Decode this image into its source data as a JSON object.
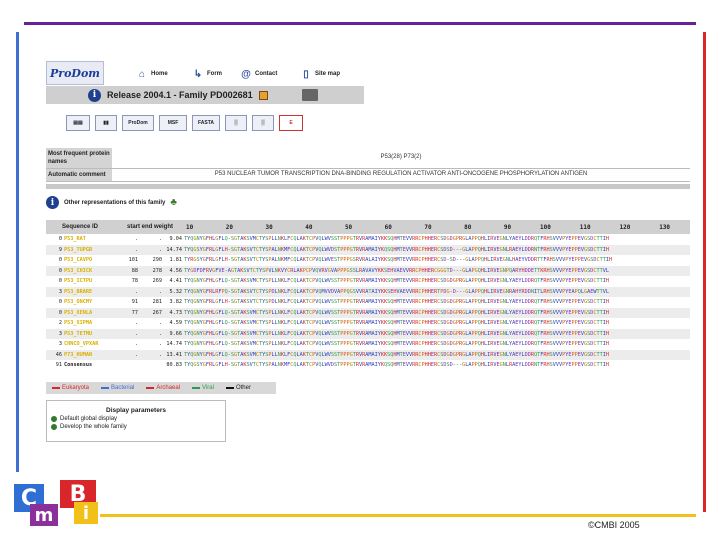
{
  "copyright": "©CMBI 2005",
  "logo": {
    "c": "C",
    "m": "m",
    "b": "B",
    "i": "i"
  },
  "nav": {
    "home": "Home",
    "form": "Form",
    "contact": "Contact",
    "sitemap": "Site map"
  },
  "prodom_logo": "ProDom",
  "release": "Release 2004.1 - Family PD002681",
  "tools": [
    "ProDom",
    "MSF",
    "FASTA"
  ],
  "info": {
    "most_frequent_label": "Most frequent protein names",
    "most_frequent_value": "P53(28) P73(2)",
    "auto_comment_label": "Automatic comment",
    "auto_comment_value": "P53 NUCLEAR TUMOR TRANSCRIPTION DNA-BINDING REGULATION ACTIVATOR ANTI-ONCOGENE PHOSPHORYLATION ANTIGEN"
  },
  "other_representations": "Other representations of this family",
  "alignment": {
    "headers": [
      "Sequence ID",
      "start end weight"
    ],
    "ruler": "10         20         30         40         50         60         70         80         90        100        110        120        130",
    "rows": [
      {
        "num": "0",
        "id": "P53_RAT",
        "start": ".",
        "end": ".",
        "weight": "9.04",
        "seq": "TYQGNYGFHLGFLQ-SGTAKSVMCTYSPLLNKLFCQLAKTCPVQLWVSSTPPPGTRVRAMAIYKKSQHMTEVVRRCPHHERCSDGDGPRGLAPPQHLIRVEGNLYAEYLDDRQTFRHSVVVPYEPPEVGSDCTTIH"
      },
      {
        "num": "9",
        "id": "P53_TUPGB",
        "start": ".",
        "end": ".",
        "weight": "14.74",
        "seq": "TYQGSYGFRLGFLH-SGTAKSVTCTYSPALNKMFCQLAKTCPVQLWVDSTPPPGTRVRAMAIYKQSQHMTEVVRRCPHHERCSDSD---GLAPPQHLIRVEGNLRAEYLDDRNTFRHSVVVPYEPPEVGSDCTTIH"
      },
      {
        "num": "0",
        "id": "P53_CAVPO",
        "start": "101",
        "end": "290",
        "weight": "1.81",
        "seq": "TYRGSYGFRLGFLH-SGTAKSVTCTYSPALNKMFCQLAKTCPVQLWVESTPPPGSRVRALAIYKKSQHMTEVVRRCPHHERCSD-SD---GLAPPQHLIRVEGNLHAEYVDDRTTFRHSVVVPYEPPEVGSDCTTIH"
      },
      {
        "num": "0",
        "id": "P53_CHICK",
        "start": "88",
        "end": "278",
        "weight": "4.56",
        "seq": "TYGDFDFRVGFVE-AGTAKSVTCTYSPVLNKVYCRLAKPCPVQVRVGVAPPPGSSLRAVAVYKKSEHVAEVVRRCPHHERCGGGTD---GLAPGQHLIRVEGNPQARYHDDETTKRHSVVVPYEPPEVGSDCTTVL"
      },
      {
        "num": "0",
        "id": "P53_ICTPU",
        "start": "78",
        "end": "269",
        "weight": "4.41",
        "seq": "TYQGNYGFHLGFLQ-SGTAKSVMCTYSPLLNKLFCQLAKTCPVQLWVSSTPPPGTRVRAMAIYKKSQHMTEVVRRCPHHERCSDGDGPRGLAPPQHLIRVEGNLYAEYLDDRQTFRHSVVVPYEPPEVGSDCTTIH"
      },
      {
        "num": "3",
        "id": "P53_BRARE",
        "start": ".",
        "end": ".",
        "weight": "5.32",
        "seq": "TYQGNYGFRLRFPQ-SGTAKSVTCTYSPDLNKLFCQLAKTCPVQMVVDVAPPQGSVVRATAIYKKSEHVAEVVRRCPHHERTPDG-D---GLAPPQHLIRVEGNRAHYRDDNITLRHSVVVPYEAPQLGAEWTTVL"
      },
      {
        "num": "0",
        "id": "P53_ONCMY",
        "start": "91",
        "end": "281",
        "weight": "3.82",
        "seq": "TYQGNYGFRLGFLH-SGTAKSVTCTYSPDLNKLFCQLAKTCPVQLWVSSTPPPGTRVRAMAIYKKSQHMTEVVRRCPHHERCSDGDGPRGLAPPQHLIRVEGNLYAEYLDDRQTFRHSVVVPYEPPEVGSDCTTIH"
      },
      {
        "num": "0",
        "id": "P53_XENLA",
        "start": "77",
        "end": "267",
        "weight": "4.73",
        "seq": "TYQGNYGFHLGFLQ-SGTAKSVMCTYSPLLNKLFCQLAKTCPVQLWVSSTPPPGTRVRAMAIYKKSQHMTEVVRRCPHHERCSDGDGPRGLAPPQHLIRVEGNLYAEYLDDRQTFRHSVVVPYEPPEVGSDCTTIH"
      },
      {
        "num": "2",
        "id": "P53_XIPMA",
        "start": ".",
        "end": ".",
        "weight": "4.59",
        "seq": "TYQGNYGFHLGFLQ-SGTAKSVMCTYSPLLNKLFCQLAKTCPVQLWVSSTPPPGTRVRAMAIYKKSQHMTEVVRRCPHHERCSDGDGPRGLAPPQHLIRVEGNLYAEYLDDRQTFRHSVVVPYEPPEVGSDCTTIH"
      },
      {
        "num": "3",
        "id": "P53_TETMU",
        "start": ".",
        "end": ".",
        "weight": "9.66",
        "seq": "TYQGNYGFHLGFLQ-SGTAKSVMCTYSPLLNKLFCQLAKTCPVQLWVSSTPPPGTRVRAMAIYKKSQHMTEVVRRCPHHERCSDGDGPRGLAPPQHLIRVEGNLYAEYLDDRQTFRHSVVVPYEPPEVGSDCTTIH"
      },
      {
        "num": "3",
        "id": "CHNCO_VPXAR",
        "start": ".",
        "end": ".",
        "weight": "14.74",
        "seq": "TYQGNYGFHLGFLQ-SGTAKSVMCTYSPLLNKLFCQLAKTCPVQLWVSSTPPPGTRVRAMAIYKKSQHMTEVVRRCPHHERCSDGDGPRGLAPPQHLIRVEGNLYAEYLDDRQTFRHSVVVPYEPPEVGSDCTTIH"
      },
      {
        "num": "46",
        "id": "P73_HUMAN",
        "start": ".",
        "end": ".",
        "weight": "13.41",
        "seq": "TYQGNYGFHLGFLQ-SGTAKSVMCTYSPLLNKLFCQLAKTCPVQLWVSSTPPPGTRVRAMAIYKKSQHMTEVVRRCPHHERCSDGDGPRGLAPPQHLIRVEGNLYAEYLDDRQTFRHSVVVPYEPPEVGSDCTTIH"
      },
      {
        "num": "91",
        "id": "Consensus",
        "start": "",
        "end": "",
        "weight": "80.83",
        "seq": "TYQGSYGFRLGFLH-SGTAKSVTCTYSPALNKMFCQLAKTCPVQLWVDSTPPPGTRVRAMAIYKQSQHMTEVVRRCPHHERCSDSD---GLAPPQHLIRVEGNLRAEYLDDRNTFRHSVVVPYEPPEVGSDCTTIH"
      }
    ]
  },
  "legend": [
    {
      "label": "Eukaryota",
      "color": "#d8262a"
    },
    {
      "label": "Bacterial",
      "color": "#3f6fd0"
    },
    {
      "label": "Archaeal",
      "color": "#d8262a"
    },
    {
      "label": "Viral",
      "color": "#2f9a4a"
    },
    {
      "label": "Other",
      "color": "#111111"
    }
  ],
  "display": {
    "title": "Display parameters",
    "default": "Default global display",
    "develop": "Develop the whole family"
  }
}
